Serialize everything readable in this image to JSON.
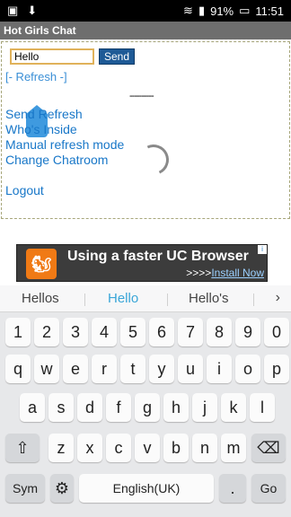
{
  "status": {
    "battery": "91%",
    "time": "11:51"
  },
  "page": {
    "title": "Hot Girls Chat"
  },
  "chat": {
    "input_value": "Hello",
    "send_label": "Send",
    "refresh_label": "[- Refresh -]",
    "divider": "----------",
    "menu": [
      "Send Refresh",
      "Who's Inside",
      "Manual refresh mode",
      "Change Chatroom",
      "Logout"
    ]
  },
  "ad": {
    "title": "Using a faster UC Browser",
    "prefix": ">>>>",
    "link": "Install Now",
    "info": "i"
  },
  "keyboard": {
    "suggestions": [
      "Hellos",
      "Hello",
      "Hello's"
    ],
    "row_numbers": [
      "1",
      "2",
      "3",
      "4",
      "5",
      "6",
      "7",
      "8",
      "9",
      "0"
    ],
    "row1": [
      "q",
      "w",
      "e",
      "r",
      "t",
      "y",
      "u",
      "i",
      "o",
      "p"
    ],
    "row2": [
      "a",
      "s",
      "d",
      "f",
      "g",
      "h",
      "j",
      "k",
      "l"
    ],
    "row3": [
      "z",
      "x",
      "c",
      "v",
      "b",
      "n",
      "m"
    ],
    "sym_label": "Sym",
    "space_label": "English(UK)",
    "period": ".",
    "go_label": "Go",
    "shift_icon": "shift-icon",
    "backspace_icon": "backspace-icon",
    "settings_icon": "gear-icon"
  }
}
